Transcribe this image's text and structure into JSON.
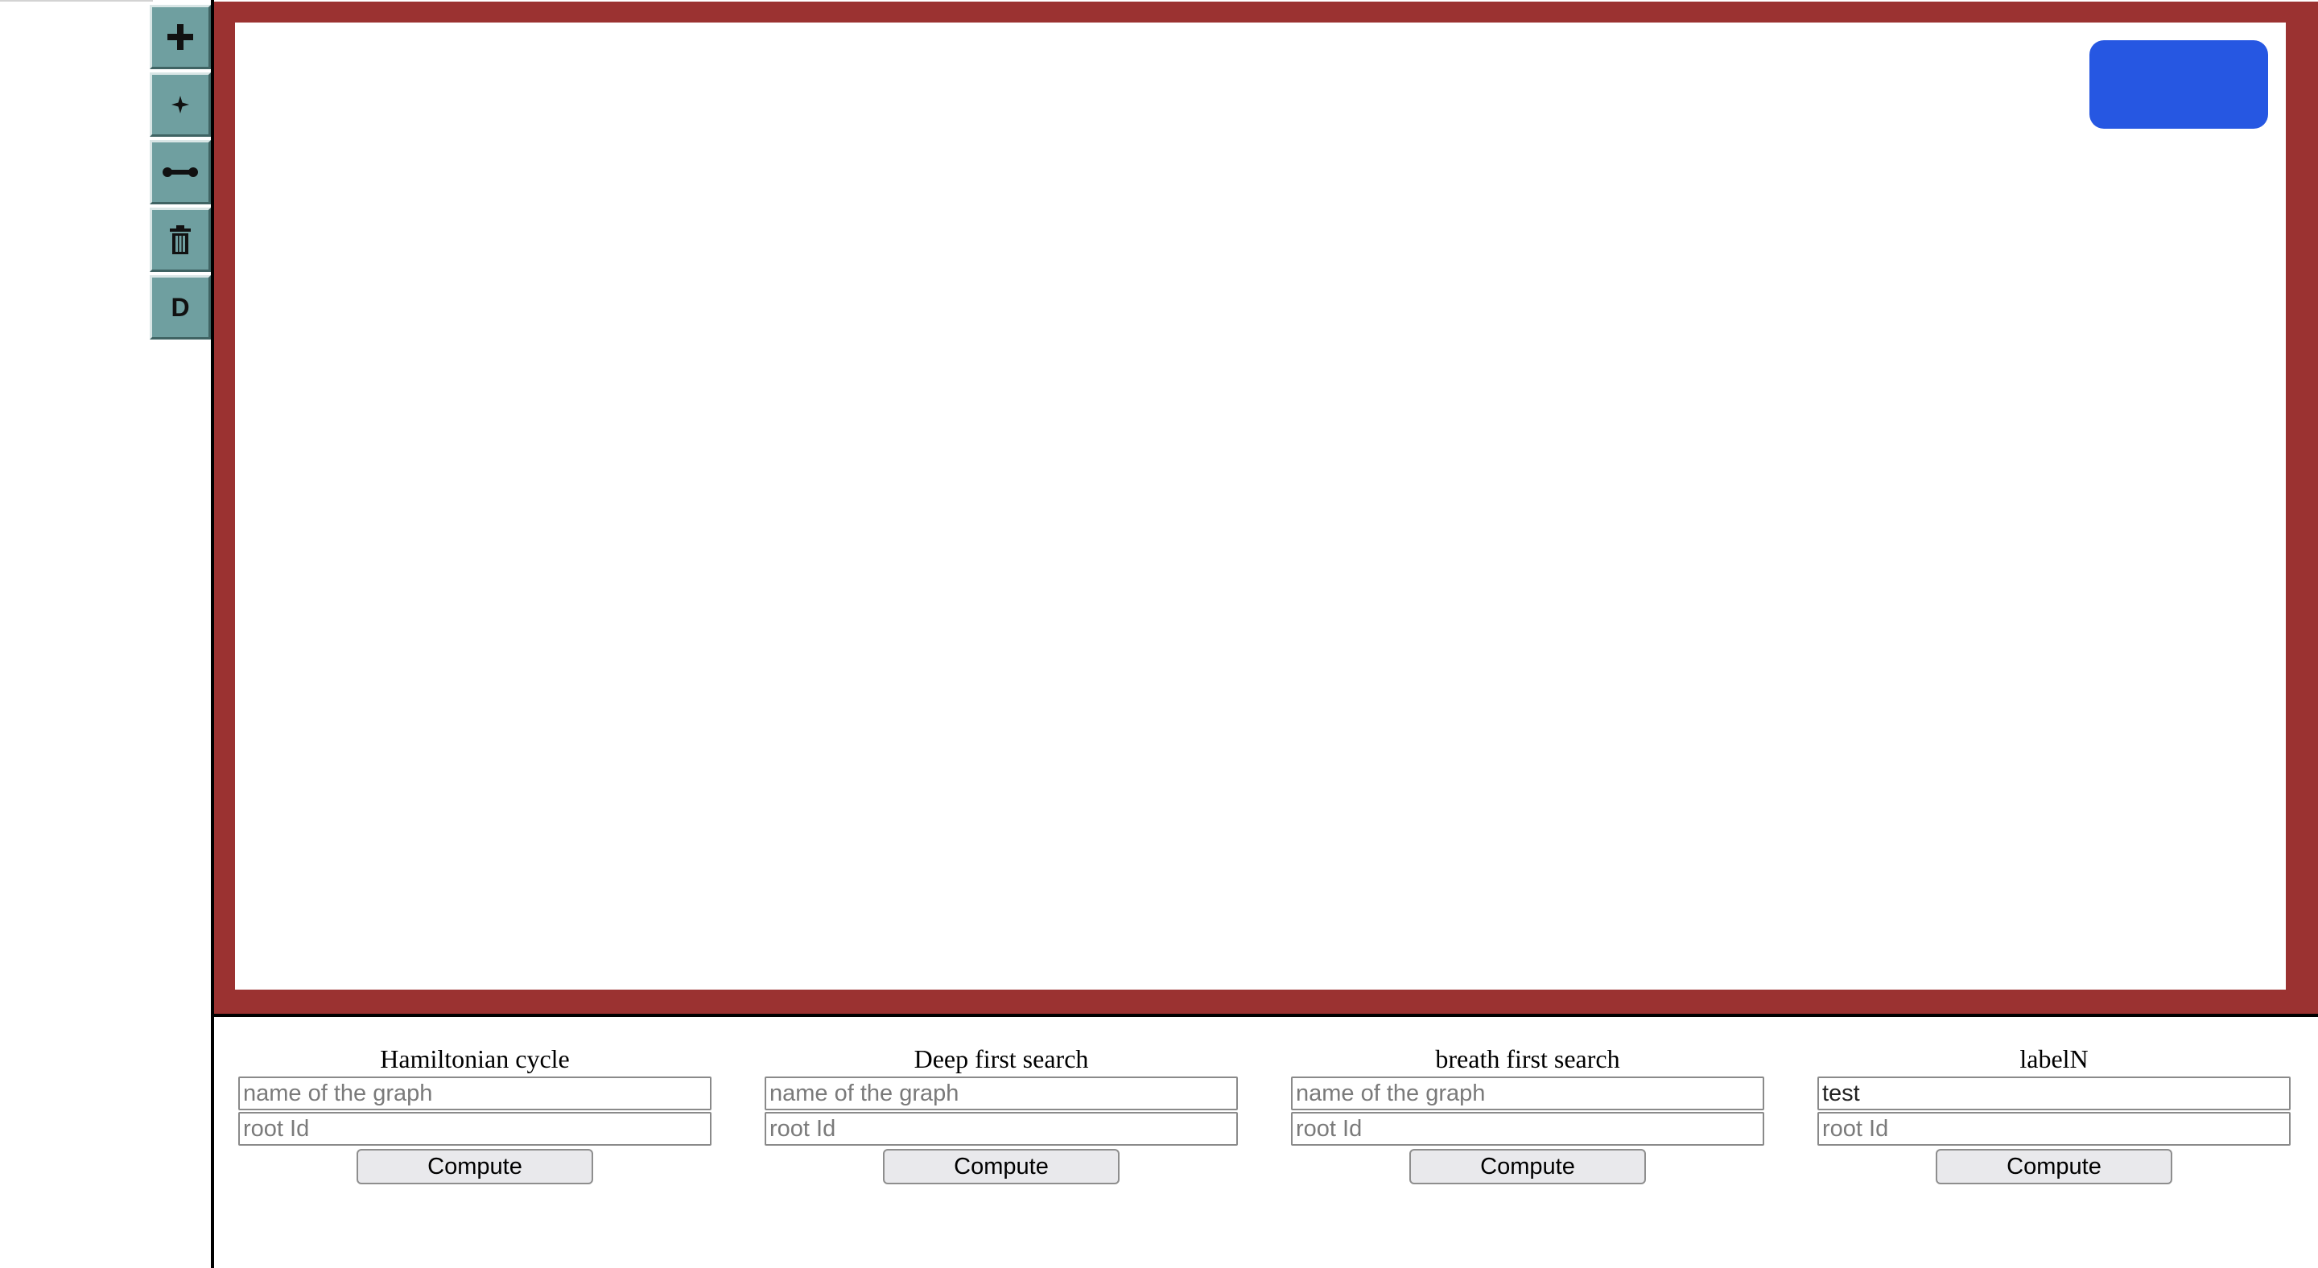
{
  "toolbar": {
    "buttons": [
      {
        "icon": "plus-icon"
      },
      {
        "icon": "node-star-icon"
      },
      {
        "icon": "edge-icon"
      },
      {
        "icon": "trash-icon"
      },
      {
        "icon": "letter-d-icon",
        "label": "D"
      }
    ]
  },
  "colors": {
    "frame": "#9b3231",
    "toolbar": "#6f9fa0",
    "accent_button": "#2657e2"
  },
  "panels": [
    {
      "title": "Hamiltonian cycle",
      "graph_placeholder": "name of the graph",
      "graph_value": "",
      "root_placeholder": "root Id",
      "button": "Compute"
    },
    {
      "title": "Deep first search",
      "graph_placeholder": "name of the graph",
      "graph_value": "",
      "root_placeholder": "root Id",
      "button": "Compute"
    },
    {
      "title": "breath first search",
      "graph_placeholder": "name of the graph",
      "graph_value": "",
      "root_placeholder": "root Id",
      "button": "Compute"
    },
    {
      "title": "labelN",
      "graph_placeholder": "",
      "graph_value": "test",
      "root_placeholder": "root Id",
      "button": "Compute"
    }
  ]
}
